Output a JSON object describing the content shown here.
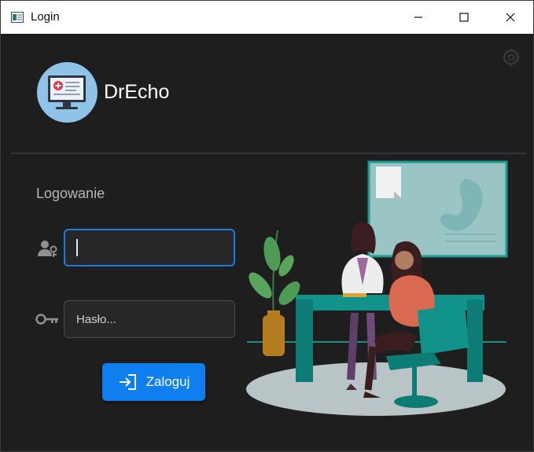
{
  "window": {
    "title": "Login",
    "controls": {
      "minimize": "minimize-icon",
      "maximize": "maximize-icon",
      "close": "close-icon"
    }
  },
  "brand": {
    "name": "DrEcho",
    "logo_icon": "monitor-medical-icon"
  },
  "settings_icon": "gear-icon",
  "login": {
    "heading": "Logowanie",
    "username": {
      "value": "",
      "placeholder": "",
      "icon": "user-key-icon"
    },
    "password": {
      "value": "",
      "placeholder": "Hasło...",
      "icon": "key-icon"
    },
    "submit_label": "Zaloguj",
    "submit_icon": "sign-in-icon"
  },
  "colors": {
    "background": "#1e1e1f",
    "accent": "#0f7ff0",
    "focus_border": "#1f7ae0",
    "field_bg": "#27272a",
    "teal": "#10897f"
  },
  "illustration": {
    "description_icon": "doctor-patient-illustration"
  }
}
